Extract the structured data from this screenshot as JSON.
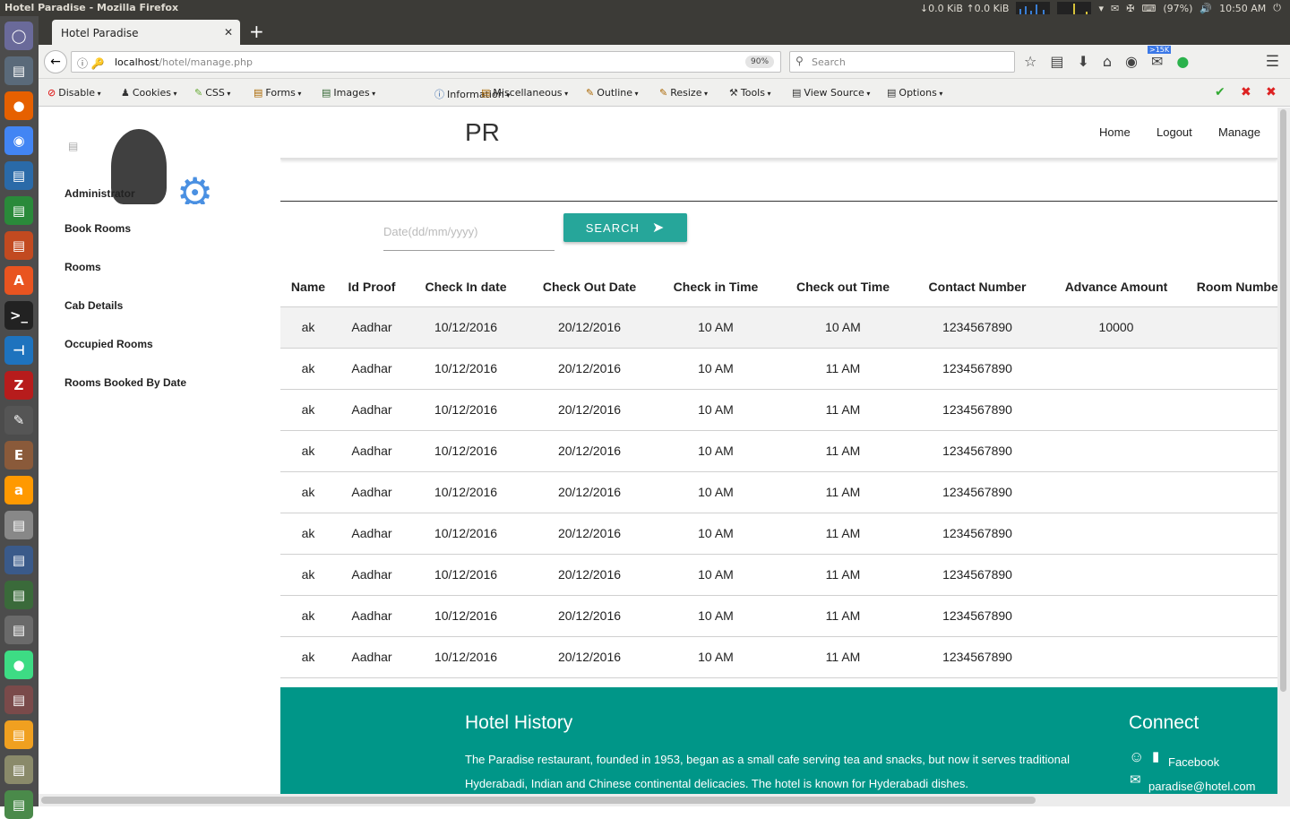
{
  "os": {
    "window_title": "Hotel Paradise - Mozilla Firefox",
    "net": "↓0.0 KiB ↑0.0 KiB",
    "battery": "(97%)",
    "time": "10:50 AM"
  },
  "launcher": {
    "icons": [
      "ubuntu-icon",
      "files-icon",
      "firefox-icon",
      "chrome-icon",
      "writer-icon",
      "calc-icon",
      "impress-icon",
      "software-center-icon",
      "terminal-icon",
      "vscode-icon",
      "filezilla-icon",
      "text-editor-icon",
      "eric-icon",
      "amazon-icon",
      "scanner-icon",
      "system-monitor-icon",
      "device-icon",
      "disk-icon",
      "android-studio-icon",
      "sdk-icon",
      "folder-icon",
      "archive-icon",
      "drive-icon"
    ]
  },
  "browser": {
    "tab_title": "Hotel Paradise",
    "url_host": "localhost",
    "url_path": "/hotel/manage.php",
    "zoom": "90%",
    "search_placeholder": "Search",
    "badge": ">15K"
  },
  "webdev": {
    "items": [
      "Disable",
      "Cookies",
      "CSS",
      "Forms",
      "Images",
      "Information",
      "Miscellaneous",
      "Outline",
      "Resize",
      "Tools",
      "View Source",
      "Options"
    ]
  },
  "sidebar": {
    "user": "Administrator",
    "links": [
      "Book Rooms",
      "Rooms",
      "Cab Details",
      "Occupied Rooms",
      "Rooms Booked By Date"
    ]
  },
  "header": {
    "logo": "PR",
    "nav": [
      "Home",
      "Logout",
      "Manage"
    ]
  },
  "search": {
    "placeholder": "Date(dd/mm/yyyy)",
    "button": "SEARCH"
  },
  "table": {
    "columns": [
      "Name",
      "Id Proof",
      "Check In date",
      "Check Out Date",
      "Check in Time",
      "Check out Time",
      "Contact Number",
      "Advance Amount",
      "Room Number"
    ],
    "rows": [
      [
        "ak",
        "Aadhar",
        "10/12/2016",
        "20/12/2016",
        "10 AM",
        "10 AM",
        "1234567890",
        "10000",
        ""
      ],
      [
        "ak",
        "Aadhar",
        "10/12/2016",
        "20/12/2016",
        "10 AM",
        "11 AM",
        "1234567890",
        "",
        ""
      ],
      [
        "ak",
        "Aadhar",
        "10/12/2016",
        "20/12/2016",
        "10 AM",
        "11 AM",
        "1234567890",
        "",
        ""
      ],
      [
        "ak",
        "Aadhar",
        "10/12/2016",
        "20/12/2016",
        "10 AM",
        "11 AM",
        "1234567890",
        "",
        ""
      ],
      [
        "ak",
        "Aadhar",
        "10/12/2016",
        "20/12/2016",
        "10 AM",
        "11 AM",
        "1234567890",
        "",
        ""
      ],
      [
        "ak",
        "Aadhar",
        "10/12/2016",
        "20/12/2016",
        "10 AM",
        "11 AM",
        "1234567890",
        "",
        ""
      ],
      [
        "ak",
        "Aadhar",
        "10/12/2016",
        "20/12/2016",
        "10 AM",
        "11 AM",
        "1234567890",
        "",
        ""
      ],
      [
        "ak",
        "Aadhar",
        "10/12/2016",
        "20/12/2016",
        "10 AM",
        "11 AM",
        "1234567890",
        "",
        ""
      ],
      [
        "ak",
        "Aadhar",
        "10/12/2016",
        "20/12/2016",
        "10 AM",
        "11 AM",
        "1234567890",
        "",
        ""
      ]
    ]
  },
  "footer": {
    "history_title": "Hotel History",
    "history_text": "The Paradise restaurant, founded in 1953, began as a small cafe serving tea and snacks, but now it serves traditional Hyderabadi, Indian and Chinese continental delicacies. The hotel is known for Hyderabadi dishes.",
    "connect_title": "Connect",
    "facebook": "Facebook",
    "email": "paradise@hotel.com"
  },
  "colors": {
    "accent": "#26a69a",
    "footer": "#009688",
    "launcher": "#4c4c4c",
    "topbar": "#3c3b37"
  }
}
